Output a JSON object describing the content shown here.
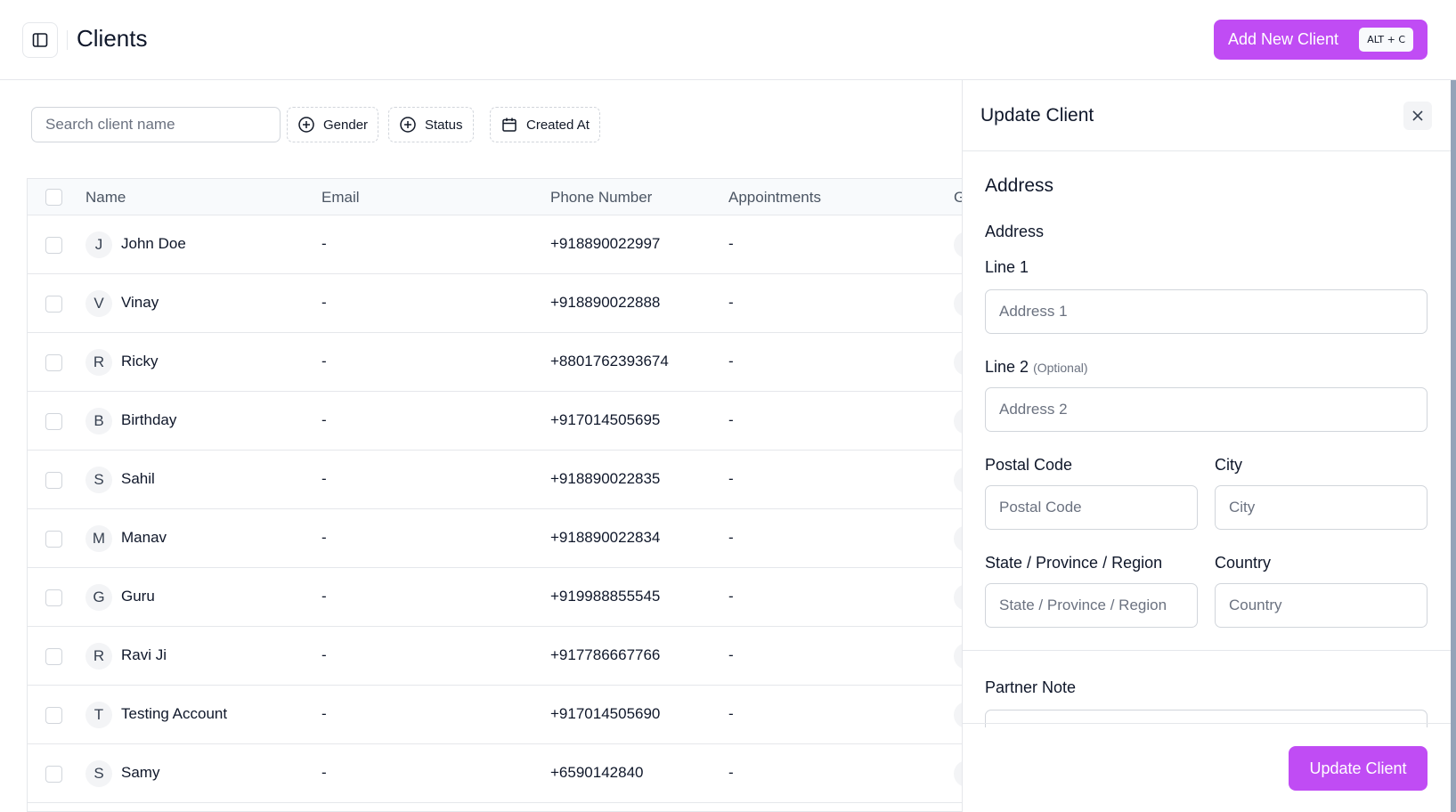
{
  "header": {
    "title": "Clients",
    "add_button": "Add New Client",
    "shortcut": "ALT + C"
  },
  "filters": {
    "search_placeholder": "Search client name",
    "gender": "Gender",
    "status": "Status",
    "created_at": "Created At"
  },
  "table": {
    "columns": [
      "Name",
      "Email",
      "Phone Number",
      "Appointments",
      "G"
    ],
    "rows": [
      {
        "initial": "J",
        "name": "John Doe",
        "email": "-",
        "phone": "+918890022997",
        "appointments": "-"
      },
      {
        "initial": "V",
        "name": "Vinay",
        "email": "-",
        "phone": "+918890022888",
        "appointments": "-"
      },
      {
        "initial": "R",
        "name": "Ricky",
        "email": "-",
        "phone": "+8801762393674",
        "appointments": "-"
      },
      {
        "initial": "B",
        "name": "Birthday",
        "email": "-",
        "phone": "+917014505695",
        "appointments": "-"
      },
      {
        "initial": "S",
        "name": "Sahil",
        "email": "-",
        "phone": "+918890022835",
        "appointments": "-"
      },
      {
        "initial": "M",
        "name": "Manav",
        "email": "-",
        "phone": "+918890022834",
        "appointments": "-"
      },
      {
        "initial": "G",
        "name": "Guru",
        "email": "-",
        "phone": "+919988855545",
        "appointments": "-"
      },
      {
        "initial": "R",
        "name": "Ravi Ji",
        "email": "-",
        "phone": "+917786667766",
        "appointments": "-"
      },
      {
        "initial": "T",
        "name": "Testing Account",
        "email": "-",
        "phone": "+917014505690",
        "appointments": "-"
      },
      {
        "initial": "S",
        "name": "Samy",
        "email": "-",
        "phone": "+6590142840",
        "appointments": "-"
      }
    ]
  },
  "drawer": {
    "title": "Update Client",
    "section_title": "Address",
    "address_label": "Address",
    "line1_label": "Line 1",
    "line1_placeholder": "Address 1",
    "line2_label": "Line 2",
    "line2_optional": "(Optional)",
    "line2_placeholder": "Address 2",
    "postal_label": "Postal Code",
    "postal_placeholder": "Postal Code",
    "city_label": "City",
    "city_placeholder": "City",
    "state_label": "State / Province / Region",
    "state_placeholder": "State / Province / Region",
    "country_label": "Country",
    "country_placeholder": "Country",
    "partner_note_label": "Partner Note",
    "update_button": "Update Client"
  },
  "colors": {
    "accent": "#c04cf4",
    "border": "#e5e7eb"
  }
}
